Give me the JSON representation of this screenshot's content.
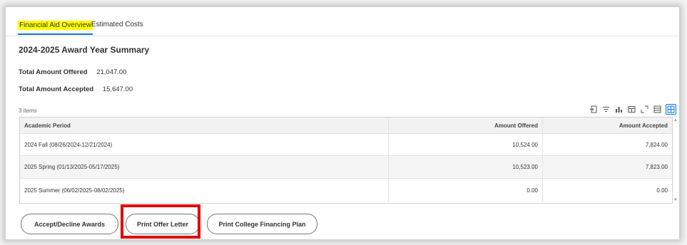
{
  "tabs": [
    {
      "label": "Financial Aid Overview",
      "active": true
    },
    {
      "label": "Estimated Costs",
      "active": false
    }
  ],
  "summary": {
    "title": "2024-2025 Award Year Summary",
    "total_offered_label": "Total Amount Offered",
    "total_offered_value": "21,047.00",
    "total_accepted_label": "Total Amount Accepted",
    "total_accepted_value": "15,647.00"
  },
  "table": {
    "items_count": "3 items",
    "headers": [
      "Academic Period",
      "Amount Offered",
      "Amount Accepted"
    ],
    "rows": [
      [
        "2024 Fall (08/26/2024-12/21/2024)",
        "10,524.00",
        "7,824.00"
      ],
      [
        "2025 Spring (01/13/2025-05/17/2025)",
        "10,523.00",
        "7,823.00"
      ],
      [
        "2025 Summer (06/02/2025-08/02/2025)",
        "0.00",
        "0.00"
      ]
    ]
  },
  "toolbar_icons": [
    "export-icon",
    "filter-icon",
    "chart-icon",
    "table-view-icon",
    "expand-icon",
    "grid-icon",
    "grid-active-icon"
  ],
  "buttons": {
    "accept_decline": "Accept/Decline Awards",
    "print_offer": "Print Offer Letter",
    "print_plan": "Print College Financing Plan"
  },
  "colors": {
    "accent": "#0875e1",
    "tab_highlight": "#ffff00",
    "annotation_box": "#e30000"
  }
}
